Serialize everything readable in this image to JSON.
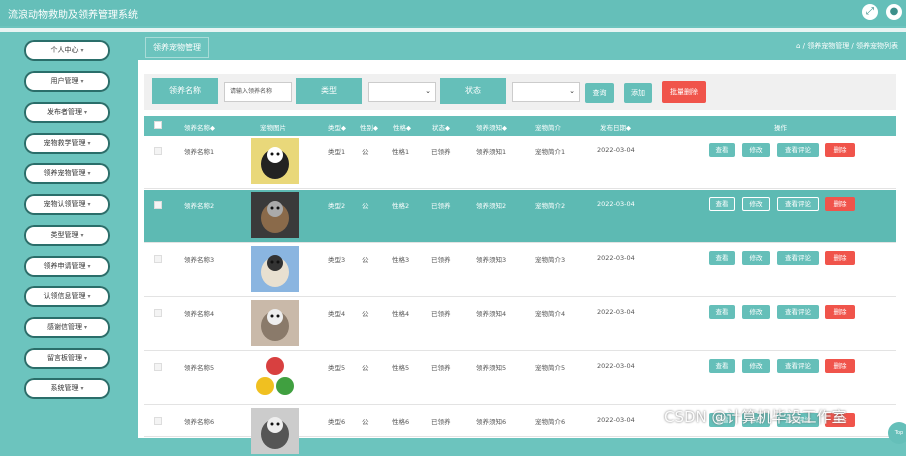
{
  "app": {
    "title": "流浪动物救助及领养管理系统"
  },
  "header_icons": [
    "fullscreen-icon",
    "user-icon"
  ],
  "sidebar": {
    "items": [
      {
        "label": "个人中心"
      },
      {
        "label": "用户管理"
      },
      {
        "label": "发布者管理"
      },
      {
        "label": "宠物救学管理"
      },
      {
        "label": "领养宠物管理"
      },
      {
        "label": "宠物认领管理"
      },
      {
        "label": "类型管理"
      },
      {
        "label": "领养申请管理"
      },
      {
        "label": "认领信息管理"
      },
      {
        "label": "感谢信管理"
      },
      {
        "label": "留言板管理"
      },
      {
        "label": "系统管理"
      }
    ]
  },
  "page": {
    "tab": "领养宠物管理",
    "breadcrumb": "⌂ / 领养宠物管理 / 领养宠物列表"
  },
  "search": {
    "name_label": "领养名称",
    "name_placeholder": "请输入领养名称",
    "type_label": "类型",
    "status_label": "状态",
    "query_btn": "查询",
    "add_btn": "添加",
    "batch_delete_btn": "批量删除"
  },
  "table": {
    "headers": [
      "领养名称◆",
      "宠物图片",
      "类型◆",
      "性别◆",
      "性格◆",
      "状态◆",
      "领养须知◆",
      "宠物简介",
      "发布日期◆",
      "操作"
    ],
    "actions": {
      "view": "查看",
      "edit": "修改",
      "comment": "查看评论",
      "delete": "删除"
    },
    "rows": [
      {
        "name": "领养名称1",
        "type": "类型1",
        "gender": "公",
        "character": "性格1",
        "status": "已领养",
        "notice": "领养须知1",
        "intro": "宠物简介1",
        "date": "2022-03-04",
        "img": "dog-photo-1"
      },
      {
        "name": "领养名称2",
        "type": "类型2",
        "gender": "公",
        "character": "性格2",
        "status": "已领养",
        "notice": "领养须知2",
        "intro": "宠物简介2",
        "date": "2022-03-04",
        "img": "dog-photo-2"
      },
      {
        "name": "领养名称3",
        "type": "类型3",
        "gender": "公",
        "character": "性格3",
        "status": "已领养",
        "notice": "领养须知3",
        "intro": "宠物简介3",
        "date": "2022-03-04",
        "img": "dog-photo-3"
      },
      {
        "name": "领养名称4",
        "type": "类型4",
        "gender": "公",
        "character": "性格4",
        "status": "已领养",
        "notice": "领养须知4",
        "intro": "宠物简介4",
        "date": "2022-03-04",
        "img": "cat-photo-4"
      },
      {
        "name": "领养名称5",
        "type": "类型5",
        "gender": "公",
        "character": "性格5",
        "status": "已领养",
        "notice": "领养须知5",
        "intro": "宠物简介5",
        "date": "2022-03-04",
        "img": "toy-balls-photo-5"
      },
      {
        "name": "领养名称6",
        "type": "类型6",
        "gender": "公",
        "character": "性格6",
        "status": "已领养",
        "notice": "领养须知6",
        "intro": "宠物简介6",
        "date": "2022-03-04",
        "img": "dog-photo-6"
      }
    ]
  },
  "back_to_top": "Top",
  "watermark": "CSDN @计算机毕设工作室",
  "colors": {
    "accent": "#65bfb9",
    "danger": "#f0544b",
    "selected_row": "#5dbab3"
  }
}
